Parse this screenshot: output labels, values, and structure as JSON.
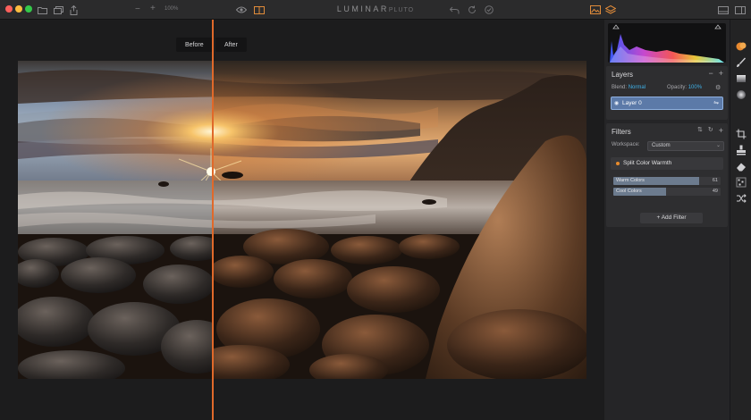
{
  "app": {
    "title_main": "LUMINAR",
    "title_sub": "PLUTO"
  },
  "toolbar": {
    "zoom_minus": "−",
    "zoom_plus": "+",
    "zoom_level": "100%"
  },
  "compare": {
    "before_label": "Before",
    "after_label": "After"
  },
  "layers": {
    "title": "Layers",
    "minus": "−",
    "plus": "+",
    "blend_label": "Blend:",
    "blend_value": "Normal",
    "opacity_label": "Opacity:",
    "opacity_value": "100%",
    "items": [
      {
        "name": "Layer 0"
      }
    ]
  },
  "filters": {
    "title": "Filters",
    "plus": "+",
    "workspace_label": "Workspace:",
    "workspace_value": "Custom",
    "active_filter": "Split Color Warmth",
    "sliders": [
      {
        "label": "Warm Colors",
        "value": "61",
        "level": 0.8
      },
      {
        "label": "Cool Colors",
        "value": "49",
        "level": 0.49
      }
    ],
    "add_filter_label": "+ Add Filter"
  },
  "colors": {
    "accent": "#3fb1e8",
    "split_line": "#e0692a",
    "layer_selected": "#5c7aa8"
  },
  "icons": {
    "toolstrip": [
      "presets-icon",
      "brush-icon",
      "gradient-icon",
      "radial-icon",
      "crop-icon",
      "clone-stamp-icon",
      "erase-icon",
      "noise-icon",
      "transform-icon"
    ]
  }
}
